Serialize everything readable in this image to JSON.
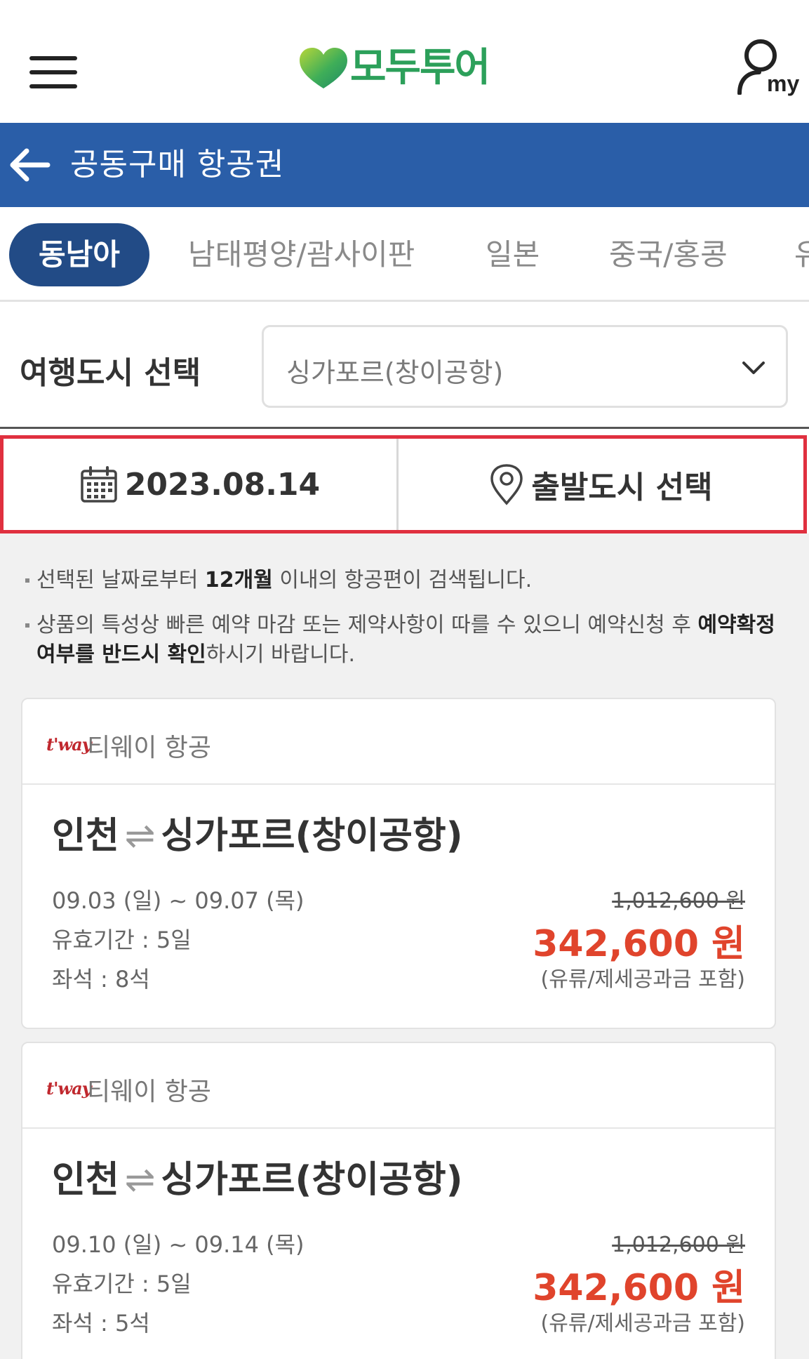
{
  "header": {
    "logo_text": "모두투어",
    "my_label": "my"
  },
  "titlebar": {
    "title": "공동구매 항공권"
  },
  "tabs": [
    {
      "label": "동남아",
      "active": true
    },
    {
      "label": "남태평양/괌사이판",
      "active": false
    },
    {
      "label": "일본",
      "active": false
    },
    {
      "label": "중국/홍콩",
      "active": false
    },
    {
      "label": "유",
      "active": false
    }
  ],
  "city": {
    "label": "여행도시 선택",
    "selected": "싱가포르(창이공항)"
  },
  "filters": {
    "date": "2023.08.14",
    "departure": "출발도시 선택"
  },
  "notices": {
    "n1_pre": "선택된 날짜로부터 ",
    "n1_bold": "12개월",
    "n1_post": " 이내의 항공편이 검색됩니다.",
    "n2_pre": "상품의 특성상 빠른 예약 마감 또는 제약사항이 따를 수 있으니 예약신청 후 ",
    "n2_bold": "예약확정 여부를 반드시 확인",
    "n2_post": "하시기 바랍니다."
  },
  "cards": [
    {
      "airline_logo": "t'way",
      "airline": "티웨이 항공",
      "origin": "인천",
      "arrows": "⇌",
      "destination": "싱가포르(창이공항)",
      "dates": "09.03 (일) ~ 09.07 (목)",
      "validity": "유효기간 : 5일",
      "seats": "좌석 : 8석",
      "original_price": "1,012,600 원",
      "sale_price": "342,600 원",
      "tax_note": "(유류/제세공과금 포함)"
    },
    {
      "airline_logo": "t'way",
      "airline": "티웨이 항공",
      "origin": "인천",
      "arrows": "⇌",
      "destination": "싱가포르(창이공항)",
      "dates": "09.10 (일) ~ 09.14 (목)",
      "validity": "유효기간 : 5일",
      "seats": "좌석 : 5석",
      "original_price": "1,012,600 원",
      "sale_price": "342,600 원",
      "tax_note": "(유류/제세공과금 포함)"
    }
  ],
  "colors": {
    "brand_green": "#2ca05a",
    "title_blue": "#2a5ea8",
    "active_tab": "#224b86",
    "highlight_red": "#e0303f",
    "price_red": "#e0442c"
  }
}
